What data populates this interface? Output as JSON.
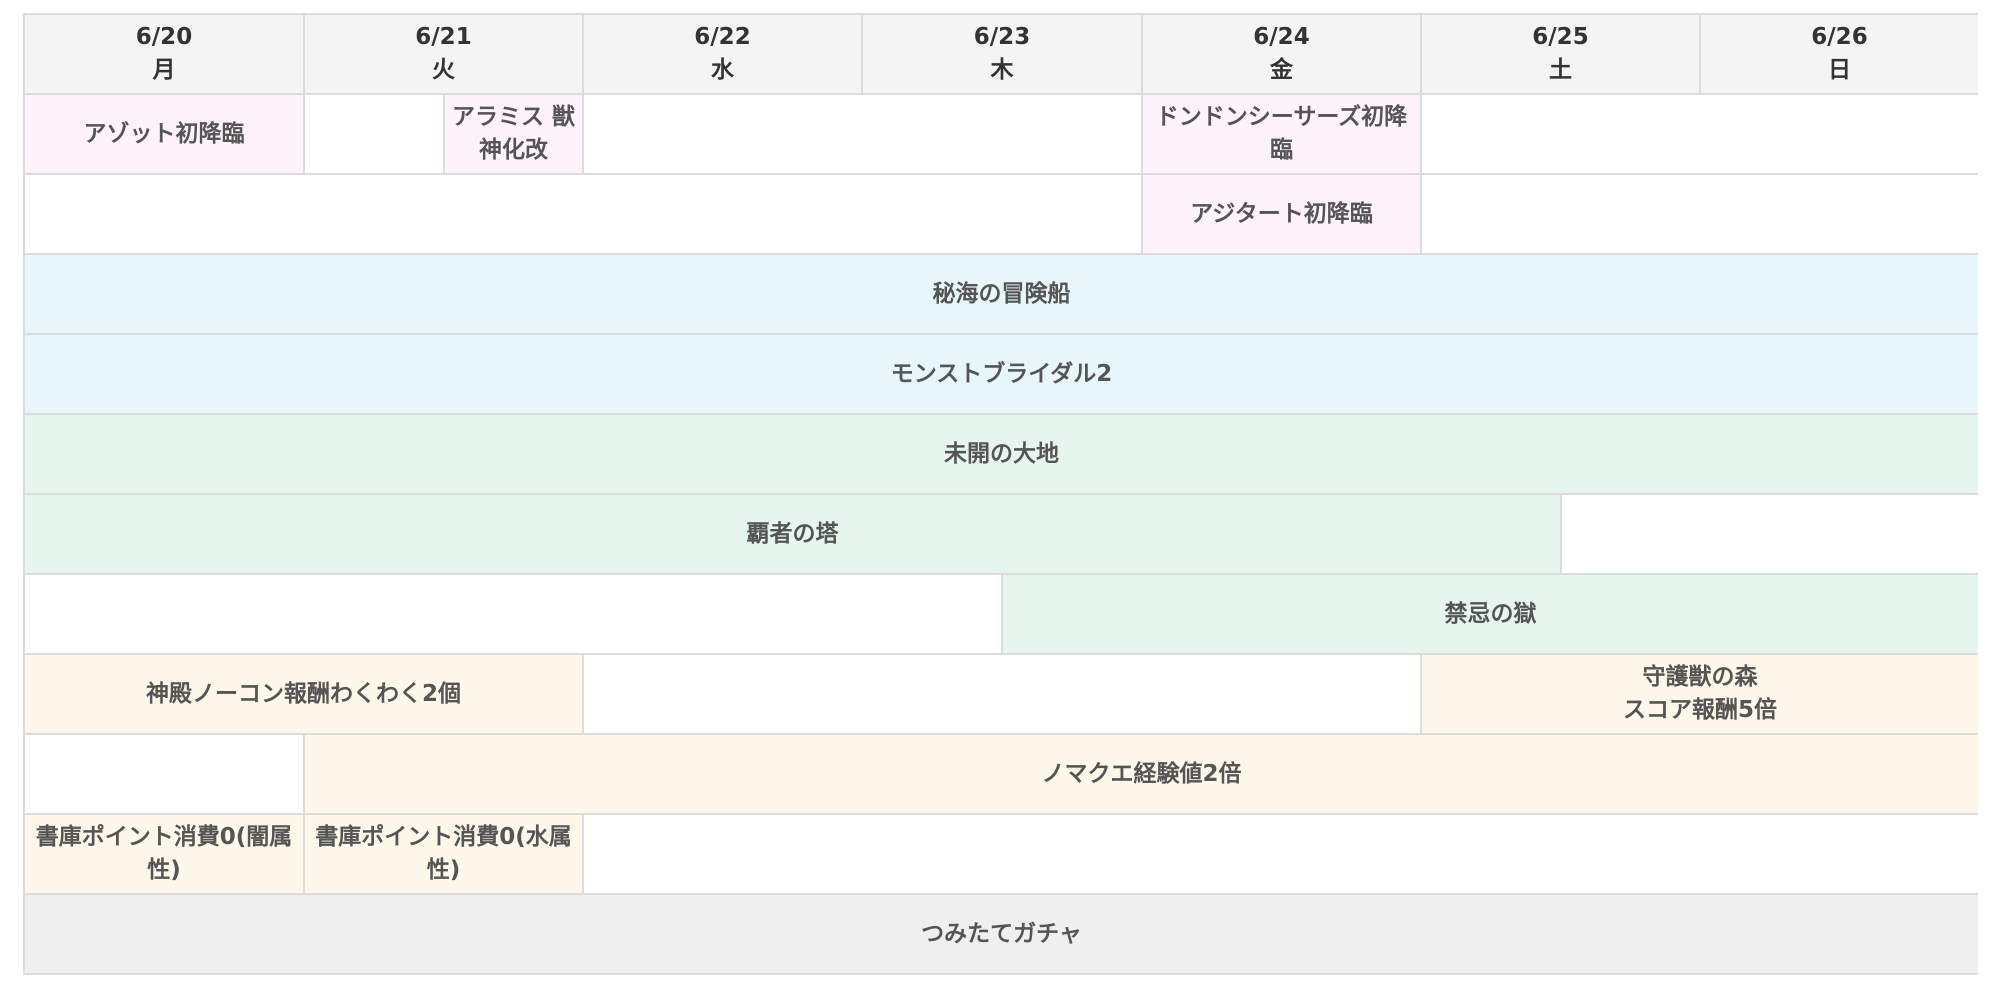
{
  "days": [
    {
      "date": "6/20",
      "weekday": "月"
    },
    {
      "date": "6/21",
      "weekday": "火"
    },
    {
      "date": "6/22",
      "weekday": "水"
    },
    {
      "date": "6/23",
      "weekday": "木"
    },
    {
      "date": "6/24",
      "weekday": "金"
    },
    {
      "date": "6/25",
      "weekday": "土"
    },
    {
      "date": "6/26",
      "weekday": "日"
    }
  ],
  "events": {
    "azot": "アゾット初降臨",
    "aramis_line1": "アラミス 獣",
    "aramis_line2": "神化改",
    "dondon_line1": "ドンドンシーサーズ初降",
    "dondon_line2": "臨",
    "azitart": "アジタート初降臨",
    "hikai": "秘海の冒険船",
    "bridal": "モンストブライダル2",
    "mikai": "未開の大地",
    "hasha": "覇者の塔",
    "kinki": "禁忌の獄",
    "shinden": "神殿ノーコン報酬わくわく2個",
    "shugo_line1": "守護獣の森",
    "shugo_line2": "スコア報酬5倍",
    "nomakue": "ノマクエ経験値2倍",
    "shoko_dark_line1": "書庫ポイント消費0(闇属",
    "shoko_dark_line2": "性)",
    "shoko_water_line1": "書庫ポイント消費0(水属",
    "shoko_water_line2": "性)",
    "tsumitate": "つみたてガチャ"
  },
  "colors": {
    "header_bg": "#f4f4f4",
    "pink": "#fff3fb",
    "blue": "#e6f6fb",
    "green": "#e6f6ee",
    "cream": "#fdf7ea",
    "gray": "#efefef",
    "border": "#dcdcdc",
    "text": "#555555"
  }
}
